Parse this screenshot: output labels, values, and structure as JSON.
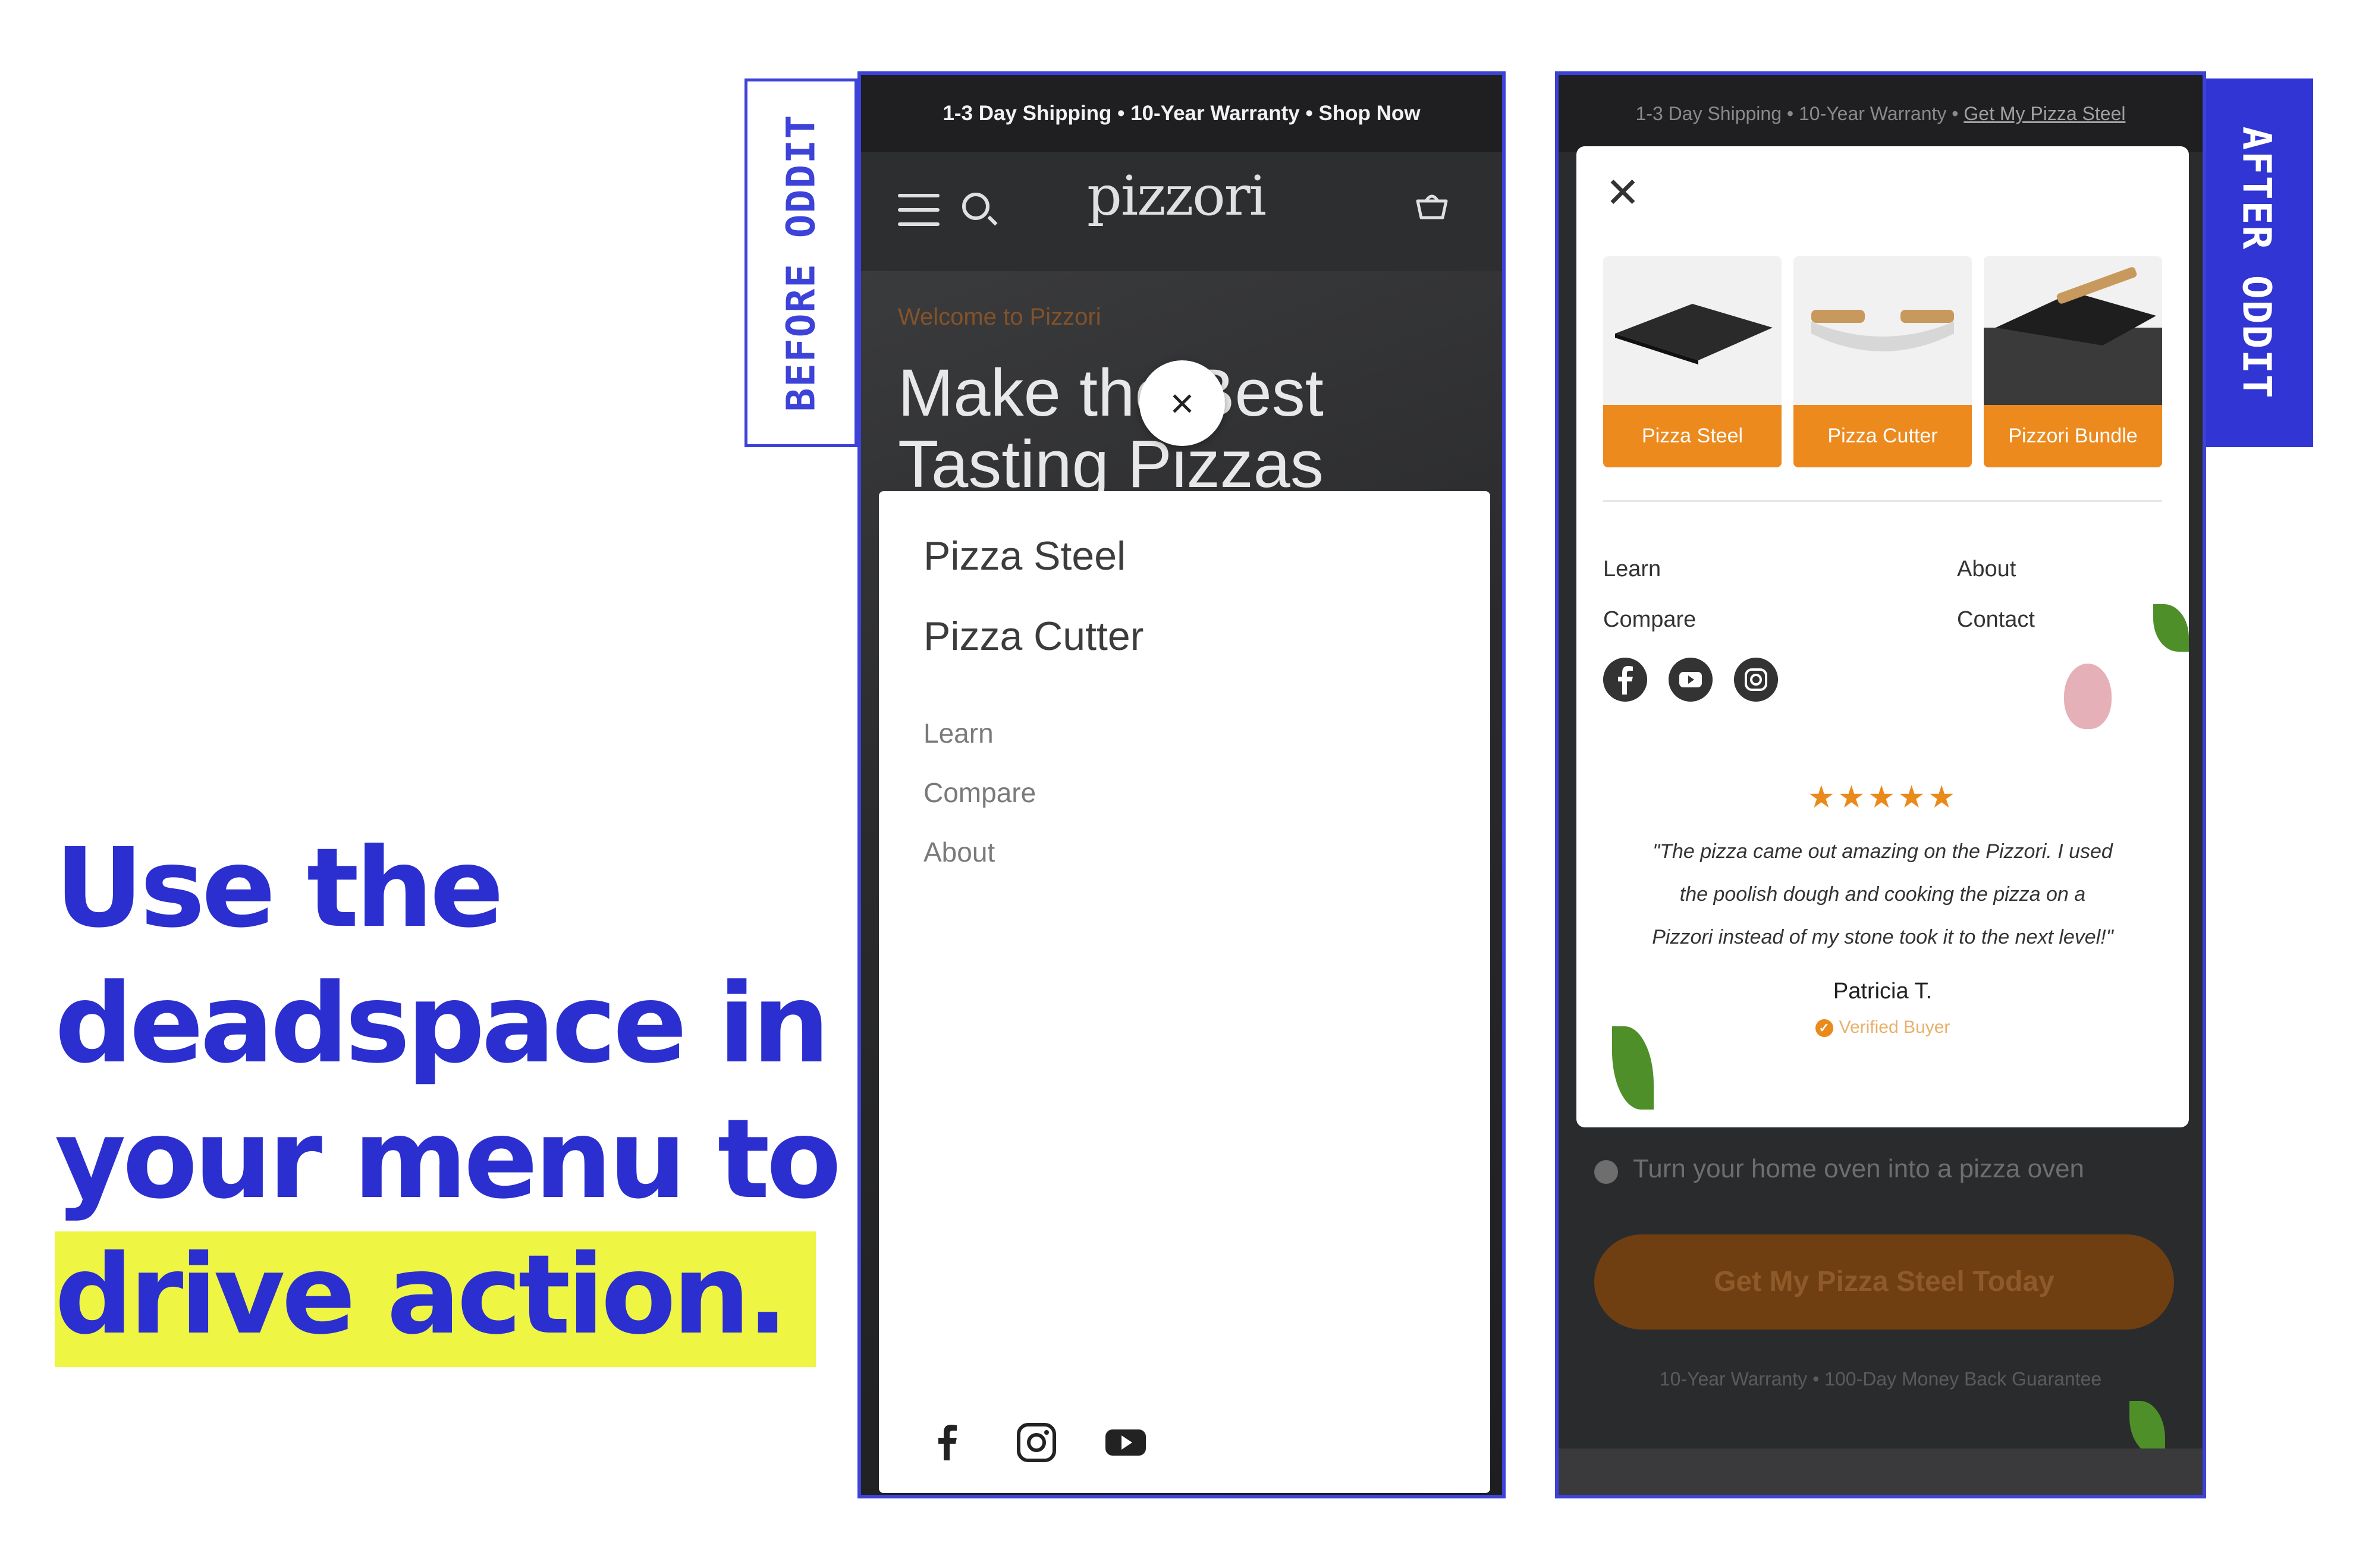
{
  "headline": {
    "line1": "Use the",
    "line2": "deadspace in",
    "line3": "your menu to",
    "line4": "drive action."
  },
  "labels": {
    "before": "BEFORE ODDIT",
    "after": "AFTER ODDIT"
  },
  "before": {
    "announcement": "1-3 Day Shipping • 10-Year Warranty • Shop Now",
    "logo": "pizzori",
    "welcome": "Welcome to Pizzori",
    "hero_line1": "Make the Best",
    "hero_line2": "Tasting Pizzas",
    "close": "×",
    "menu_primary": [
      "Pizza Steel",
      "Pizza Cutter"
    ],
    "menu_secondary": [
      "Learn",
      "Compare",
      "About"
    ],
    "social": [
      "facebook-icon",
      "instagram-icon",
      "youtube-icon"
    ]
  },
  "after": {
    "announcement_prefix": "1-3 Day Shipping • 10-Year Warranty • ",
    "announcement_link": "Get My Pizza Steel",
    "close": "✕",
    "products": [
      "Pizza Steel",
      "Pizza Cutter",
      "Pizzori Bundle"
    ],
    "links_left": [
      "Learn",
      "Compare"
    ],
    "links_right": [
      "About",
      "Contact"
    ],
    "social": [
      "facebook-icon",
      "youtube-icon",
      "instagram-icon"
    ],
    "stars": "★★★★★",
    "review_line1": "\"The pizza came out amazing on the Pizzori. I used",
    "review_line2": "the poolish dough and cooking the pizza on a",
    "review_line3": "Pizzori instead of my stone took it to the next level!\"",
    "reviewer": "Patricia T.",
    "verified": "Verified Buyer",
    "below_text": "Turn your home oven into a pizza oven",
    "cta": "Get My Pizza Steel Today",
    "guarantee": "10-Year Warranty • 100-Day Money Back Guarantee"
  },
  "colors": {
    "brand_blue": "#2b2fcf",
    "highlight": "#eef542",
    "accent_orange": "#ec8a1e",
    "dark_bg": "#2c2d2f"
  }
}
